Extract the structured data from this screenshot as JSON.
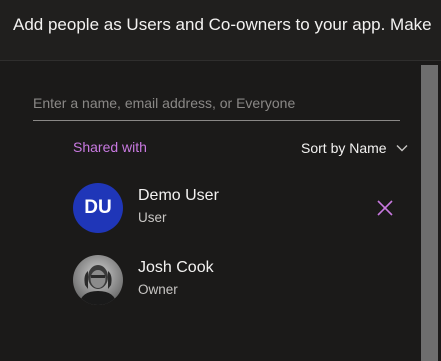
{
  "header": {
    "text": "Add people as Users and Co-owners to your app. Make"
  },
  "search": {
    "placeholder": "Enter a name, email address, or Everyone",
    "value": ""
  },
  "shared_with": {
    "label": "Shared with",
    "sort_label": "Sort by Name"
  },
  "people": [
    {
      "initials": "DU",
      "name": "Demo User",
      "role": "User"
    },
    {
      "name": "Josh Cook",
      "role": "Owner"
    }
  ],
  "colors": {
    "accent": "#c879e0",
    "avatar_blue": "#1f36b8",
    "background": "#1b1a19"
  }
}
